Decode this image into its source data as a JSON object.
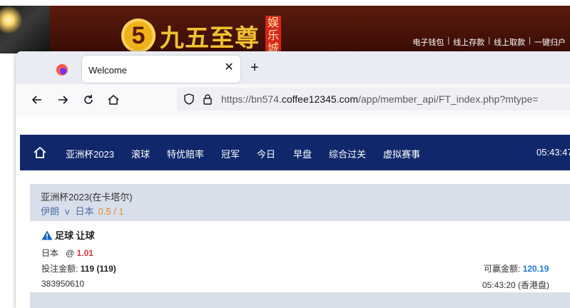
{
  "background_site": {
    "logo_mark": "5",
    "logo_text": "九五至尊",
    "logo_seal": "娱乐城",
    "links": [
      "电子钱包",
      "线上存款",
      "线上取款",
      "一键归户"
    ],
    "link_separator": "|"
  },
  "browser": {
    "tab": {
      "title": "Welcome",
      "close_glyph": "✕"
    },
    "new_tab_glyph": "+",
    "url_prefix": "https://bn574.",
    "url_domain": "coffee12345.com",
    "url_path": "/app/member_api/FT_index.php?mtype="
  },
  "site_nav": {
    "items": [
      "亚洲杯2023",
      "滚球",
      "特优赔率",
      "冠军",
      "今日",
      "早盘",
      "综合过关",
      "虚拟赛事"
    ],
    "time": "05:43:47"
  },
  "bet": {
    "league": "亚洲杯2023(在卡塔尔)",
    "home": "伊朗",
    "vs": "v",
    "away": "日本",
    "handicap": "0.5 / 1",
    "type_label": "足球 让球",
    "selection": "日本",
    "at": "@",
    "odds": "1.01",
    "stake_label": "投注金额:",
    "stake_value": "119 (119)",
    "win_label": "可赢金额:",
    "win_value": "120.19",
    "ticket_id": "383950610",
    "bet_time": "05:43:20 (香港盘)"
  },
  "colors": {
    "nav_bg": "#10286b",
    "card_bg": "#d8deea",
    "odds": "#d9363e",
    "win": "#1e7bd6",
    "handicap": "#e78a1f",
    "match_text": "#5170a8"
  }
}
